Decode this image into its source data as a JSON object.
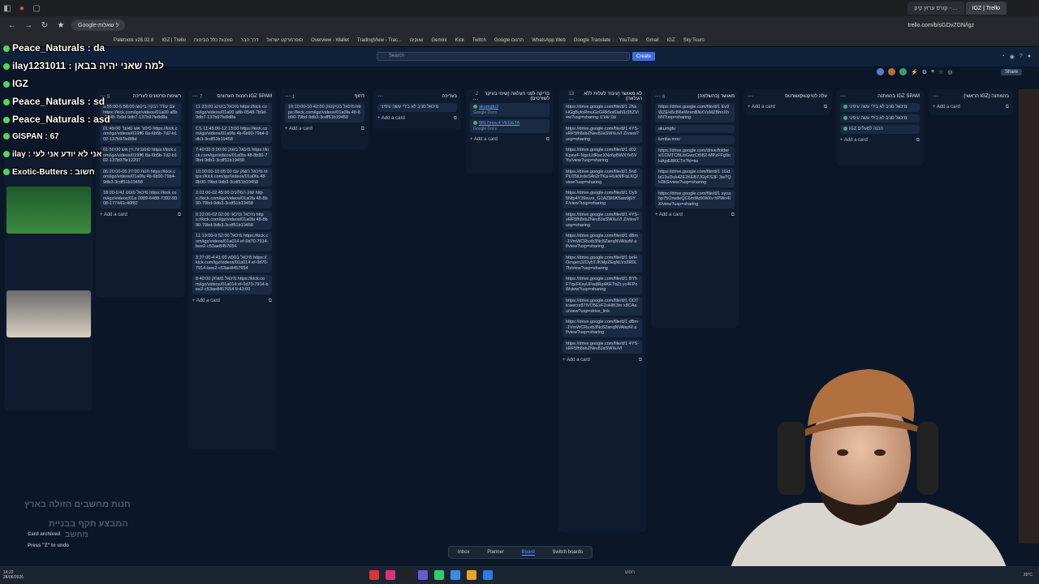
{
  "browser": {
    "tabs": [
      "קורס ערוץ קיק - ...",
      "IGZ | Trello"
    ],
    "omnibox": "Google-ל שאלות",
    "url": "trello.com/b/sGOvZGN/igz",
    "bookmarks": [
      "Paletools v26.02.8",
      "IGZ | Trello",
      "סוכנות כלל הביטוח",
      "דרך הבר",
      "סופרמרקט ישראל",
      "Overview - Wallet",
      "TradingView - Trac...",
      "שווקים",
      "Gemini",
      "Kick",
      "Twitch",
      "Google תרגום",
      "WhatsApp Web",
      "Google Translate",
      "YouTube",
      "Gmail",
      "IGZ",
      "Sky Tours"
    ]
  },
  "header": {
    "search_placeholder": "Search",
    "create_label": "Create",
    "share_label": "Share"
  },
  "chat": [
    {
      "user": "Peace_Naturals",
      "text": "da"
    },
    {
      "user": "ilay1231011",
      "text": "למה שאני יהיה בבאן"
    },
    {
      "user": "IGZ",
      "text": ""
    },
    {
      "user": "Peace_Naturals",
      "text": "sd"
    },
    {
      "user": "Peace_Naturals",
      "text": "asd"
    },
    {
      "user": "GISPAN",
      "text": "67"
    },
    {
      "user": "ilay",
      "text": "אני לא יודע אני לעי"
    },
    {
      "user": "Exotic-Butters",
      "text": "חשוב"
    }
  ],
  "lists": [
    {
      "title": "רשימת סרטונים לעריכה",
      "count": "5",
      "cards": [
        "עם עודד רבקה ביקשו 5:55:00-5:58:00 https://kick.com/igz/videos/01a00 a8b-0548-7b9d-9db7-137b97fe8d8a",
        "סיפור אש סאונד 01:49:00 https://kick.com/igz/videos/019ff6 8a-6b5b-7d2-b102-137b97fe8f8d",
        "סופגניות ויין אש 01:50:00 https://kick.com/igz/videos/019ff6 8a-6b5b-7d2-b102-137b97fe12207",
        "06:20:00-06:27:00 חנות https://kick.com/igz/videos/01a0fa 4b-6b90-79b4-9db3-3cdf51b19458",
        "מיכאל פוסט 18:00-0:42 https://kick.com/igz/videos/01a 0989-6488-7392-9308-177441c40f82"
      ],
      "add_label": "Add a card"
    },
    {
      "title": "IGZ SPAM הכנות הערוצים",
      "count": "7",
      "cards": [
        "11:23:00 מיכאל בוטינג https://kick.com/igz/videos/01a00 a8b-0548-7b9d-9db7-137b97fe8d8a",
        "CS 11:45:00-12:13:00 https://kick.com/igz/videos/01a0fa 4b-6b90-79b4-9db3-3cdf51b19458",
        "7:40:00-9:00:00 מיכאל בשוק https://kick.com/igz/videos/01a0fa 48-8b90-79bd-9db3-3cdf51b19458",
        "10:00:00-10:05:00 מיכאל השוק עם https://kick.com/igz/videos/01a0fa 48-8b90-79bd-9db3-3cdf51b19458",
        "2:01:00-02:45:00 שוק המלונים https://kick.com/igz/videos/01a0fa 48-8b90-79bd-9db3-3cdf51b19458",
        "0:22:00-02:02:00 מיכאל וסיכאי https://kick.com/igz/videos/01a0fa 48-8b90-79bd-9db3-3cdf51b19458",
        "11:19:00-9:52:00 מיכאל https://kick.com/igz/videos/01a014 ef-0d70-7914-bee2-c53ae8457654",
        "3:27:00-4:41:00 מיכאל בספא https://kick.com/igz/videos/01a014 ef-0d70-7914-bee2-c53ae8457654",
        "8:40:00 מיכאל משחק https://kick.com/igz/videos/01a014 ef-0d70-7914-bee2-c53ae8457654 9:43:00"
      ],
      "add_label": "Add a card"
    },
    {
      "title": "דחוף",
      "count": "1",
      "cards": [
        "10:10:00-10:42:00 מיכאל בטיקטוק https://kick.com/igz/videos/01a0fa 48-8b90-79bd-9db3-3cdf51b19458"
      ],
      "add_label": "Add a card"
    },
    {
      "title": "בעריכה",
      "count": "",
      "cards": [
        "מיכאל סניב לא בידי עשה עיפיני"
      ],
      "add_label": "Add a card"
    },
    {
      "title": "בדיקה לפני העלאה (שינוי בעיקר לשורטים)",
      "count": "2",
      "docs": [
        {
          "name": "akumgfu2",
          "sub": "Google Docs"
        },
        {
          "name": "0817mov.4 VEGETA",
          "sub": "Google Docs"
        }
      ],
      "add_label": "Add a card"
    },
    {
      "title": "לא מאושר (עיבוד לעלות ללא העלאה)",
      "count": "13",
      "cards": [
        "https://drive.google.com/file/d/1 2NsHGgByfoRmuGzGRk5oi6IaN1t35ZView?usp=sharing עם שורט",
        "https://drive.google.com/file/d/1 4YS-xRF5fh8xbZNev8JaSWXuVI Z/view?usp=sharing",
        "https://drive.google.com/file/d/1 d02KpswF-NgoUdRacXNz6pBWXYe5VYu/view?usp=sharing",
        "https://drive.google.com/file/d/1 5ndPU35iLlrdeS4n2rTKa-HUkNfFqLKQ/view?usp=sharing",
        "https://drive.google.com/file/d/1 Oy95Ntp4Y39svzx_G1AZ8I6KSaw9j0YF/view?usp=sharing",
        "https://drive.google.com/file/d/1 4YS-xRF5fh8xbZNev8JaSWXuVI Z/view?usp=sharing",
        "https://drive.google.com/file/d/1 dBm-1VmWCRuxb3Nc8ZanqNVAlszM af/view?usp=sharing",
        "https://drive.google.com/file/d/1 beHOmgeriJZDybTJKMpZEqNLVs3R0L7b/view?usp=sharing",
        "https://drive.google.com/file/d/1 BYhFTqvFKsyUFwdRq4KETbZt yc4FPoWview?usp=sharing",
        "https://drive.google.com/file/d/1 OOTicawcrz87IVO5EvF2oHiK3m x8CAau/view?usp=drive_link",
        "https://drive.google.com/file/d/1 dBm-1VmWCRuxb3Nc8ZanqNVAlszM af/view?usp=sharing",
        "https://drive.google.com/file/d/1 4YS-xRF5fh8xbZNev8JaSWXuVI"
      ],
      "add_label": "Add a card"
    },
    {
      "title": "מאושר (בהשלמה)",
      "count": "6",
      "cards": [
        "https://drive.google.com/file/d/1 Ev9WZEH5cB6eWrenBNXVsMZBhnXhbN?usp=sharing",
        "akumgfu",
        "lumba.mov",
        "https://drive.google.com/drive/folders/1CMTCBUoGwzCt5B2-MPzFFg9oHAjoEBKCTn?hl=iw",
        "https://drive.google.com/file/d/1 1GdbG3uDuk42E2KEB7JGyFS3F 3wTQH3kS/view?usp=sharing",
        "https://drive.google.com/file/d/1 syoahp75OrwdeQC6mfAdXWXv hPWn4IX/view?usp=sharing"
      ],
      "add_label": "Add a card"
    },
    {
      "title": "עלה לטיקטוק/שורטס",
      "count": "",
      "cards": [],
      "add_label": "Add a card"
    },
    {
      "title": "IGZ SPAM בהמתנה",
      "count": "",
      "cards": [
        "מיכאל סניב לא בידי עשה עיפיני",
        "מיכאל סניב לא בידי עשה עיפיני",
        "IGZ הכנה למעלים"
      ],
      "add_label": "Add a card"
    },
    {
      "title": "בהמתנה (IGZ הראשי)",
      "count": "",
      "cards": [],
      "add_label": "Add a card"
    }
  ],
  "bottom_nav": [
    "Inbox",
    "Planner",
    "Board",
    "Switch boards"
  ],
  "overlay_text": [
    "חנות מחשבים הזולה בארץ",
    "המבצע תקף בבניית",
    "מחשב",
    "Card archived",
    "Press \"Z\" to undo"
  ],
  "taskbar": {
    "date": "28/06/2026",
    "time": "14:22",
    "search": "חפש",
    "temp": "29°C"
  },
  "colors": {
    "board_bg": "#0b1729",
    "list_bg": "#0f1c2f",
    "card_bg": "#1a2a42",
    "accent": "#3b6fd8",
    "link": "#6aa0ff"
  }
}
